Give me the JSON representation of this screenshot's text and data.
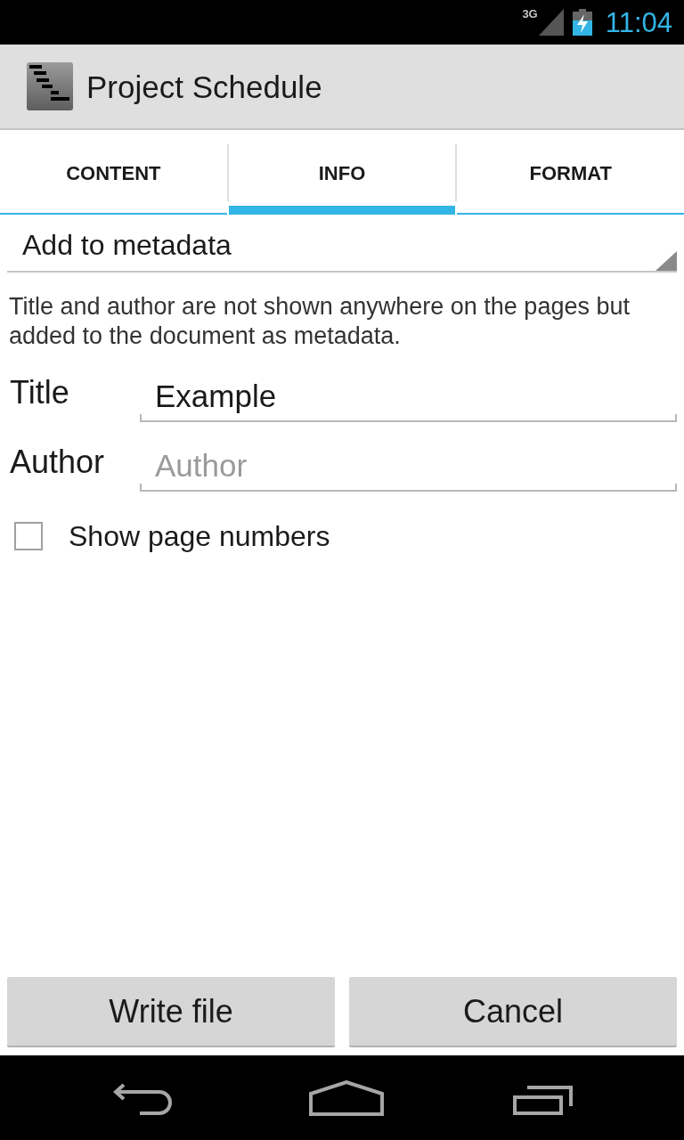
{
  "status_bar": {
    "network": "3G",
    "time": "11:04"
  },
  "action_bar": {
    "title": "Project Schedule"
  },
  "tabs": [
    {
      "label": "CONTENT",
      "selected": false
    },
    {
      "label": "INFO",
      "selected": true
    },
    {
      "label": "FORMAT",
      "selected": false
    }
  ],
  "dropdown": {
    "value": "Add to metadata"
  },
  "description": "Title and author are not shown anywhere on the pages but added to the document as metadata.",
  "fields": [
    {
      "label": "Title",
      "value": "Example"
    },
    {
      "label": "Author",
      "placeholder": "Author"
    }
  ],
  "checkbox": {
    "label": "Show page numbers",
    "checked": false
  },
  "buttons": [
    "Write file",
    "Cancel"
  ]
}
